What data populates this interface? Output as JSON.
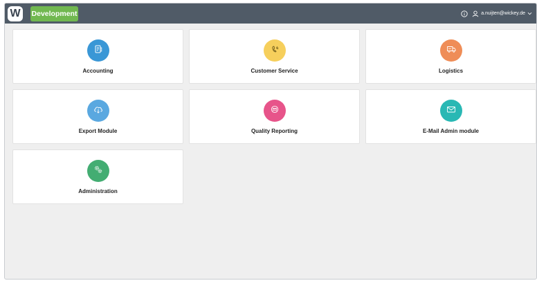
{
  "topbar": {
    "logo_letter": "W",
    "env_label": "Development",
    "user_email": "a.nuijten@wickey.de"
  },
  "modules": [
    {
      "label": "Accounting",
      "icon": "document-icon",
      "color": "#3a97d6"
    },
    {
      "label": "Customer Service",
      "icon": "phone-icon",
      "color": "#f6cf5c"
    },
    {
      "label": "Logistics",
      "icon": "truck-icon",
      "color": "#ef8d57"
    },
    {
      "label": "Export Module",
      "icon": "cloud-download-icon",
      "color": "#5aa8e0"
    },
    {
      "label": "Quality Reporting",
      "icon": "mail-badge-icon",
      "color": "#e7548a"
    },
    {
      "label": "E-Mail Admin module",
      "icon": "envelope-icon",
      "color": "#29b8b4"
    },
    {
      "label": "Administration",
      "icon": "gears-icon",
      "color": "#43ad72"
    }
  ]
}
